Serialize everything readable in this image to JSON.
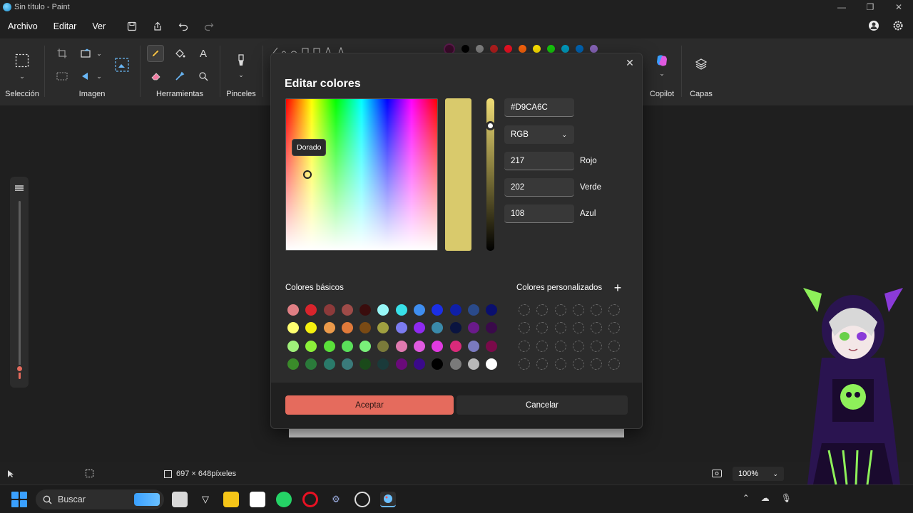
{
  "window": {
    "title": "Sin título - Paint",
    "controls": [
      "—",
      "❐",
      "✕"
    ]
  },
  "menu": {
    "items": [
      "Archivo",
      "Editar",
      "Ver"
    ]
  },
  "ribbon": {
    "groups": [
      {
        "label": "Selección"
      },
      {
        "label": "Imagen"
      },
      {
        "label": "Herramientas"
      },
      {
        "label": "Pinceles"
      },
      {
        "label": "Copilot"
      },
      {
        "label": "Capas"
      }
    ],
    "palette": [
      "#5a1a4a",
      "#000000",
      "#7f7f7f",
      "#b01e1e",
      "#e81123",
      "#f7630c",
      "#fce100",
      "#16c60c",
      "#0099bc",
      "#0063b1",
      "#8764b8"
    ]
  },
  "dialog": {
    "title": "Editar colores",
    "tooltip": "Dorado",
    "hex": "#D9CA6C",
    "mode": "RGB",
    "red": {
      "value": "217",
      "label": "Rojo"
    },
    "green": {
      "value": "202",
      "label": "Verde"
    },
    "blue": {
      "value": "108",
      "label": "Azul"
    },
    "basic_label": "Colores básicos",
    "custom_label": "Colores personalizados",
    "accept": "Aceptar",
    "cancel": "Cancelar",
    "basic_colors": [
      "#e07f84",
      "#d9242c",
      "#8c3a3a",
      "#9e4b48",
      "#3a0d0d",
      "#97f7f7",
      "#38e0e8",
      "#3f8ef0",
      "#1b2fe6",
      "#0f1fa8",
      "#2a4a8a",
      "#0a0f6e",
      "#ffff70",
      "#f5f00f",
      "#eb9a4a",
      "#e07a3a",
      "#7a4a14",
      "#a0a040",
      "#7c7cf0",
      "#8f2af0",
      "#3a8aaa",
      "#0a1440",
      "#6a1a8a",
      "#3a0a4a",
      "#a0f07a",
      "#8cf03a",
      "#5ae03a",
      "#5ae05a",
      "#7af07a",
      "#7a7a3a",
      "#e07ab0",
      "#e05ae0",
      "#e03ae0",
      "#d92a7a",
      "#7a7abf",
      "#7a0a4a",
      "#3a8a2a",
      "#2a7a3a",
      "#2a7a6a",
      "#3a7a7a",
      "#1a4a1a",
      "#1a3a3a",
      "#6a0a7a",
      "#3a0a8a",
      "#000000",
      "#7a7a7a",
      "#b8b8b8",
      "#ffffff"
    ]
  },
  "status": {
    "canvas_size": "697 × 648píxeles",
    "zoom": "100%"
  },
  "taskbar": {
    "search_placeholder": "Buscar"
  }
}
